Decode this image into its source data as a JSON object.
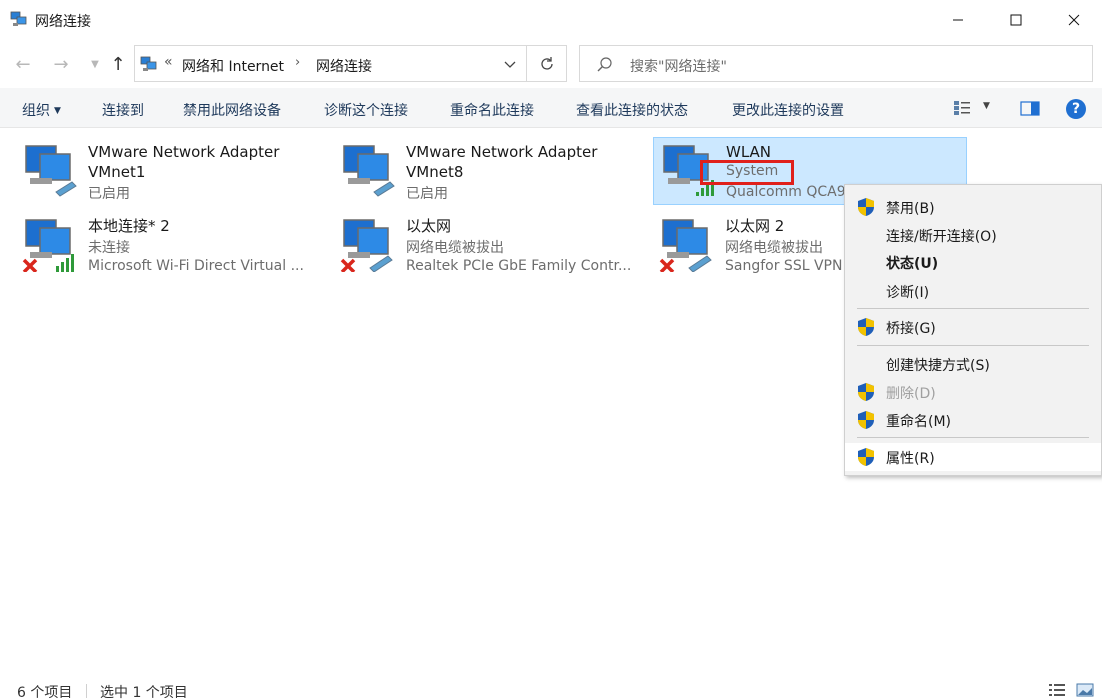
{
  "window": {
    "title": "网络连接"
  },
  "address": {
    "separator": "«",
    "crumbs": [
      "网络和 Internet",
      "网络连接"
    ],
    "crumb_arrow": "›",
    "search_placeholder": "搜索\"网络连接\""
  },
  "commands": {
    "organize": "组织",
    "connect_to": "连接到",
    "disable_device": "禁用此网络设备",
    "diagnose": "诊断这个连接",
    "rename": "重命名此连接",
    "view_status": "查看此连接的状态",
    "change_settings": "更改此连接的设置"
  },
  "items": [
    {
      "name": "VMware Network Adapter",
      "name2": "VMnet1",
      "status": "已启用"
    },
    {
      "name": "VMware Network Adapter",
      "name2": "VMnet8",
      "status": "已启用"
    },
    {
      "name": "WLAN",
      "status": "System",
      "device": "Qualcomm QCA9"
    },
    {
      "name": "本地连接* 2",
      "status": "未连接",
      "device": "Microsoft Wi-Fi Direct Virtual ..."
    },
    {
      "name": "以太网",
      "status": "网络电缆被拔出",
      "device": "Realtek PCIe GbE Family Contr..."
    },
    {
      "name": "以太网 2",
      "status": "网络电缆被拔出",
      "device": "Sangfor SSL VPN"
    }
  ],
  "context_menu": {
    "disable": "禁用(B)",
    "connect_disconnect": "连接/断开连接(O)",
    "status": "状态(U)",
    "diagnose": "诊断(I)",
    "bridge": "桥接(G)",
    "create_shortcut": "创建快捷方式(S)",
    "delete": "删除(D)",
    "rename": "重命名(M)",
    "properties": "属性(R)"
  },
  "statusbar": {
    "count": "6 个项目",
    "selected": "选中 1 个项目"
  },
  "colors": {
    "accent": "#1f6fd1",
    "selection": "#cce8ff",
    "highlight": "#e0201b"
  }
}
